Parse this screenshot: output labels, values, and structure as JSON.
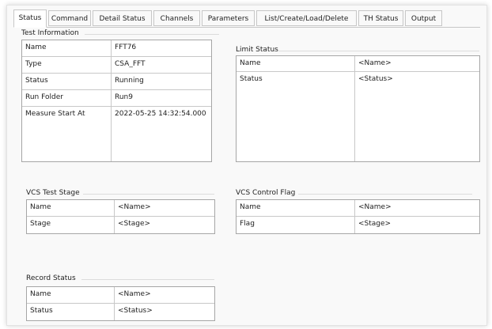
{
  "tabs": [
    {
      "label": "Status",
      "active": true
    },
    {
      "label": "Command"
    },
    {
      "label": "Detail Status"
    },
    {
      "label": "Channels"
    },
    {
      "label": "Parameters"
    },
    {
      "label": "List/Create/Load/Delete"
    },
    {
      "label": "TH Status"
    },
    {
      "label": "Output"
    }
  ],
  "test_information": {
    "title": "Test Information",
    "rows": [
      {
        "key": "Name",
        "value": "FFT76"
      },
      {
        "key": "Type",
        "value": "CSA_FFT"
      },
      {
        "key": "Status",
        "value": "Running"
      },
      {
        "key": "Run Folder",
        "value": "Run9"
      },
      {
        "key": "Measure Start At",
        "value": "2022-05-25 14:32:54.000"
      }
    ]
  },
  "limit_status": {
    "title": "Limit Status",
    "rows": [
      {
        "key": "Name",
        "value": "<Name>"
      },
      {
        "key": "Status",
        "value": "<Status>"
      }
    ]
  },
  "vcs_test_stage": {
    "title": "VCS Test Stage",
    "rows": [
      {
        "key": "Name",
        "value": "<Name>"
      },
      {
        "key": "Stage",
        "value": "<Stage>"
      }
    ]
  },
  "vcs_control_flag": {
    "title": "VCS Control Flag",
    "rows": [
      {
        "key": "Name",
        "value": "<Name>"
      },
      {
        "key": "Flag",
        "value": "<Stage>"
      }
    ]
  },
  "record_status": {
    "title": "Record Status",
    "rows": [
      {
        "key": "Name",
        "value": "<Name>"
      },
      {
        "key": "Status",
        "value": "<Status>"
      }
    ]
  }
}
